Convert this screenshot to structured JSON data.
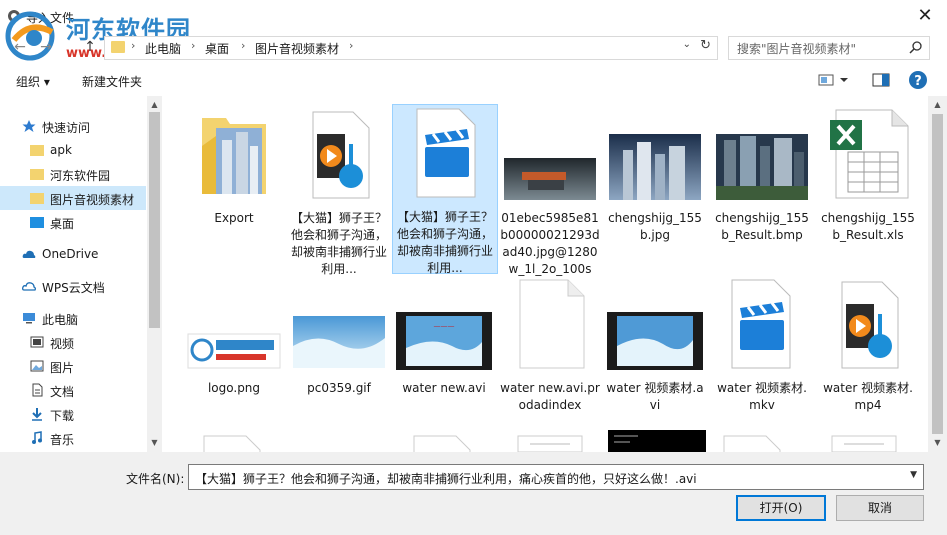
{
  "window": {
    "title": "导入文件",
    "close_label": "✕"
  },
  "watermark": {
    "title": "河东软件园",
    "url": "www.pc0359.cn"
  },
  "nav": {
    "back": "←",
    "forward": "→",
    "up": "↑",
    "breadcrumbs": [
      "此电脑",
      "桌面",
      "图片音视频素材"
    ],
    "search_placeholder": "搜索\"图片音视频素材\""
  },
  "toolbar": {
    "organize": "组织 ▾",
    "new_folder": "新建文件夹"
  },
  "sidebar": {
    "items": [
      {
        "label": "快速访问",
        "icon": "star-icon",
        "level": 0
      },
      {
        "label": "apk",
        "icon": "folder-icon",
        "level": 1
      },
      {
        "label": "河东软件园",
        "icon": "folder-icon",
        "level": 1
      },
      {
        "label": "图片音视频素材",
        "icon": "folder-icon",
        "level": 1,
        "selected": true
      },
      {
        "label": "桌面",
        "icon": "desktop-icon",
        "level": 1
      },
      {
        "label": "OneDrive",
        "icon": "cloud-icon",
        "level": 0
      },
      {
        "label": "WPS云文档",
        "icon": "cloud-icon",
        "level": 0
      },
      {
        "label": "此电脑",
        "icon": "computer-icon",
        "level": 0
      },
      {
        "label": "视频",
        "icon": "video-icon",
        "level": 1
      },
      {
        "label": "图片",
        "icon": "picture-icon",
        "level": 1
      },
      {
        "label": "文档",
        "icon": "document-icon",
        "level": 1
      },
      {
        "label": "下载",
        "icon": "download-icon",
        "level": 1
      },
      {
        "label": "音乐",
        "icon": "music-icon",
        "level": 1
      }
    ]
  },
  "files": [
    {
      "name": "Export",
      "kind": "folder"
    },
    {
      "name": "【大猫】狮子王？他会和狮子沟通，却被南非捕狮行业利用...",
      "kind": "media-player"
    },
    {
      "name": "【大猫】狮子王？他会和狮子沟通，却被南非捕狮行业利用...",
      "kind": "video-clap",
      "selected": true
    },
    {
      "name": "01ebec5985e81b00000021293dad40.jpg@1280w_1l_2o_100sh...",
      "kind": "photo-building-night"
    },
    {
      "name": "chengshijg_155b.jpg",
      "kind": "photo-city"
    },
    {
      "name": "chengshijg_155b_Result.bmp",
      "kind": "photo-city-pixel"
    },
    {
      "name": "chengshijg_155b_Result.xls",
      "kind": "excel"
    },
    {
      "name": "logo.png",
      "kind": "logo"
    },
    {
      "name": "pc0359.gif",
      "kind": "photo-wave"
    },
    {
      "name": "water new.avi",
      "kind": "film-wave-title"
    },
    {
      "name": "water new.avi.prodadindex",
      "kind": "blank"
    },
    {
      "name": "water 视频素材.avi",
      "kind": "film-wave"
    },
    {
      "name": "water 视频素材.mkv",
      "kind": "video-clap"
    },
    {
      "name": "water 视频素材.mp4",
      "kind": "media-player"
    }
  ],
  "bottom": {
    "filename_label": "文件名(N):",
    "filename_value": "【大猫】狮子王？他会和狮子沟通，却被南非捕狮行业利用，痛心疾首的他，只好这么做！.avi",
    "open_label": "打开(O)",
    "cancel_label": "取消"
  },
  "colors": {
    "selection": "#cde8fb",
    "accent": "#0078d7",
    "folder": "#f3d36f"
  }
}
